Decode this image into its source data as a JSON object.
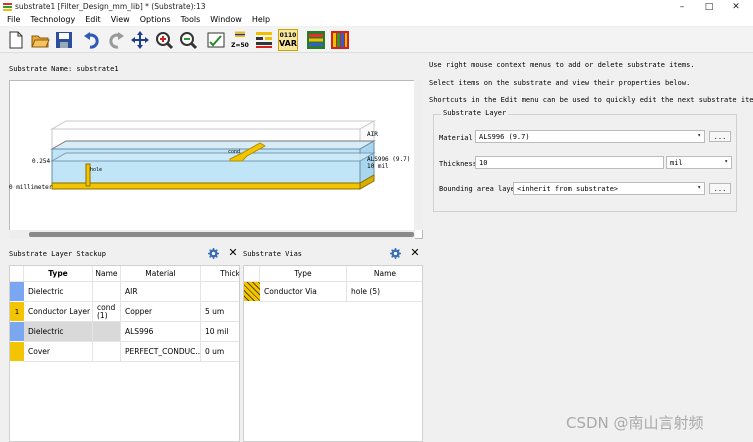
{
  "window": {
    "title": "substrate1 [Filter_Design_mm_lib] * (Substrate):13",
    "minimize": "–",
    "maximize": "□",
    "close": "✕"
  },
  "menu": [
    "File",
    "Technology",
    "Edit",
    "View",
    "Options",
    "Tools",
    "Window",
    "Help"
  ],
  "toolbar": {
    "z50": "Z=50",
    "var_top": "0110",
    "var_bottom": "VAR"
  },
  "substrate_name_label": "Substrate Name:  substrate1",
  "view3d": {
    "air": "AIR",
    "als_line1": "ALS996 (9.7)",
    "als_line2": "10 mil",
    "left_value": "0.254",
    "left_units": "0 millimeter",
    "cond_label": "cond",
    "hole_label": "hole"
  },
  "stackup": {
    "title": "Substrate Layer Stackup",
    "columns": [
      "Type",
      "Name",
      "Material",
      "Thick"
    ],
    "rows": [
      {
        "color": "#7aa7f0",
        "index": "",
        "type": "Dielectric",
        "name": "",
        "material": "AIR",
        "thick": ""
      },
      {
        "color": "#f2c500",
        "index": "1",
        "type": "Conductor Layer",
        "name": "cond\n(1)",
        "material": "Copper",
        "thick": "5 um"
      },
      {
        "color": "#7aa7f0",
        "index": "",
        "type": "Dielectric",
        "name": "",
        "material": "ALS996",
        "thick": "10 mil"
      },
      {
        "color": "#f2c500",
        "index": "",
        "type": "Cover",
        "name": "",
        "material": "PERFECT_CONDUC...",
        "thick": "0 um"
      }
    ]
  },
  "vias": {
    "title": "Substrate Vias",
    "columns": [
      "Type",
      "Name"
    ],
    "rows": [
      {
        "type": "Conductor Via",
        "name": "hole (5)"
      }
    ]
  },
  "hints": [
    "Use right mouse context menus to add or delete substrate items.",
    "Select items on the substrate and view their properties below.",
    "Shortcuts in the Edit menu can be used to quickly edit the next substrate item."
  ],
  "substrate_layer": {
    "title": "Substrate Layer",
    "material_label": "Material",
    "material_value": "ALS996 (9.7)",
    "thickness_label": "Thickness",
    "thickness_value": "10",
    "thickness_unit": "mil",
    "bounding_label": "Bounding area layer:",
    "bounding_value": "<inherit from substrate>",
    "dots": "..."
  },
  "watermark": "CSDN @南山言射频",
  "colors": {
    "dielectric": "#7aa7f0",
    "conductor": "#f2c500",
    "selected_row": "#d9d9d9"
  }
}
